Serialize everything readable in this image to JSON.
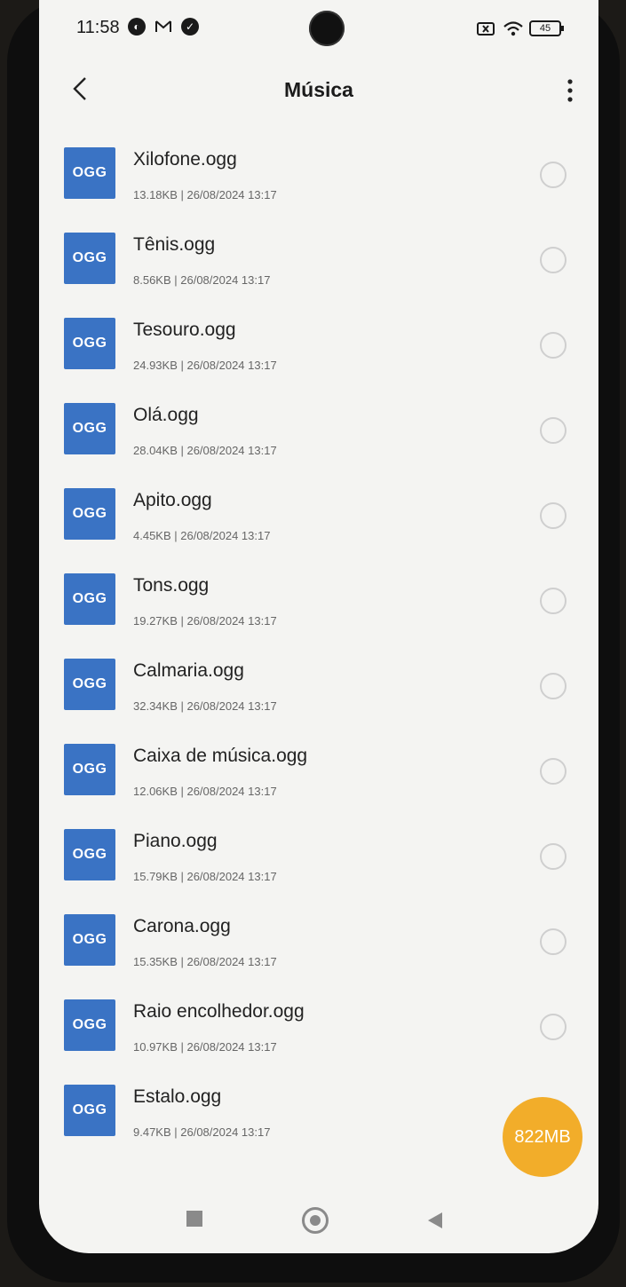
{
  "status_bar": {
    "time": "11:58",
    "icons_left": [
      "app-icon",
      "gmail-icon",
      "check-icon"
    ],
    "icons_right": [
      "no-sim-icon",
      "wifi-icon"
    ],
    "battery": "45"
  },
  "header": {
    "title": "Música"
  },
  "files": [
    {
      "name": "Xilofone.ogg",
      "meta": "13.18KB  |  26/08/2024 13:17",
      "type": "OGG"
    },
    {
      "name": "Tênis.ogg",
      "meta": "8.56KB  |  26/08/2024 13:17",
      "type": "OGG"
    },
    {
      "name": "Tesouro.ogg",
      "meta": "24.93KB  |  26/08/2024 13:17",
      "type": "OGG"
    },
    {
      "name": "Olá.ogg",
      "meta": "28.04KB  |  26/08/2024 13:17",
      "type": "OGG"
    },
    {
      "name": "Apito.ogg",
      "meta": "4.45KB  |  26/08/2024 13:17",
      "type": "OGG"
    },
    {
      "name": "Tons.ogg",
      "meta": "19.27KB  |  26/08/2024 13:17",
      "type": "OGG"
    },
    {
      "name": "Calmaria.ogg",
      "meta": "32.34KB  |  26/08/2024 13:17",
      "type": "OGG"
    },
    {
      "name": "Caixa de música.ogg",
      "meta": "12.06KB  |  26/08/2024 13:17",
      "type": "OGG"
    },
    {
      "name": "Piano.ogg",
      "meta": "15.79KB  |  26/08/2024 13:17",
      "type": "OGG"
    },
    {
      "name": "Carona.ogg",
      "meta": "15.35KB  |  26/08/2024 13:17",
      "type": "OGG"
    },
    {
      "name": "Raio encolhedor.ogg",
      "meta": "10.97KB  |  26/08/2024 13:17",
      "type": "OGG"
    },
    {
      "name": "Estalo.ogg",
      "meta": "9.47KB  |  26/08/2024 13:17",
      "type": "OGG"
    }
  ],
  "fab": {
    "label": "822MB",
    "color": "#f2ad2a"
  },
  "colors": {
    "ogg_badge": "#3a73c4"
  }
}
